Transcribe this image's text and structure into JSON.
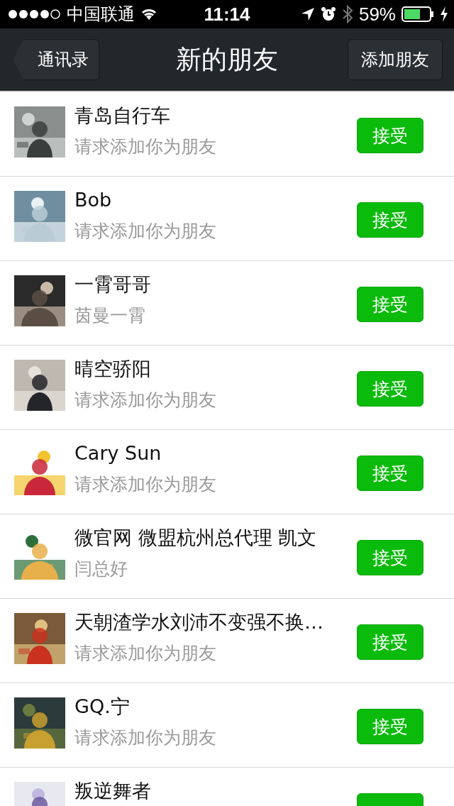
{
  "status_bar": {
    "carrier": "中国联通",
    "time": "11:14",
    "battery": "59%"
  },
  "nav_bar": {
    "back": "通讯录",
    "title": "新的朋友",
    "action": "添加朋友"
  },
  "requests": [
    {
      "name": "青岛自行车",
      "message": "请求添加你为朋友",
      "accept": "接受"
    },
    {
      "name": "Bob",
      "message": "请求添加你为朋友",
      "accept": "接受"
    },
    {
      "name": "一霄哥哥",
      "message": "茵曼一霄",
      "accept": "接受"
    },
    {
      "name": "晴空骄阳",
      "message": "请求添加你为朋友",
      "accept": "接受"
    },
    {
      "name": "Cary Sun",
      "message": "请求添加你为朋友",
      "accept": "接受"
    },
    {
      "name": "微官网 微盟杭州总代理 凯文",
      "message": "闫总好",
      "accept": "接受"
    },
    {
      "name": "天朝渣学水刘沛不变强不换…",
      "message": "请求添加你为朋友",
      "accept": "接受"
    },
    {
      "name": "GQ.宁",
      "message": "请求添加你为朋友",
      "accept": "接受"
    },
    {
      "name": "叛逆舞者"
    }
  ]
}
